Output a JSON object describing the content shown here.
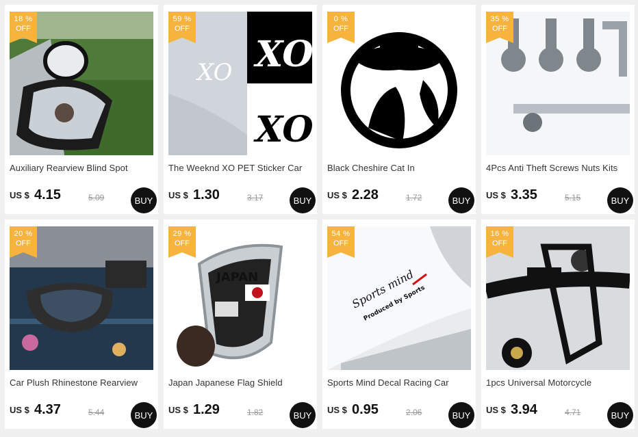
{
  "products": [
    {
      "discount_pct": "18 %",
      "discount_off": "OFF",
      "title": "Auxiliary Rearview Blind Spot",
      "currency": "US $",
      "price": "4.15",
      "old_price": "5.09",
      "buy_label": "BUY"
    },
    {
      "discount_pct": "59 %",
      "discount_off": "OFF",
      "title": "The Weeknd XO PET Sticker Car",
      "currency": "US $",
      "price": "1.30",
      "old_price": "3.17",
      "buy_label": "BUY",
      "image_text": "XO"
    },
    {
      "discount_pct": "0 %",
      "discount_off": "OFF",
      "title": "Black Cheshire Cat In",
      "currency": "US $",
      "price": "2.28",
      "old_price": "1.72",
      "buy_label": "BUY"
    },
    {
      "discount_pct": "35 %",
      "discount_off": "OFF",
      "title": "4Pcs Anti Theft Screws Nuts Kits",
      "currency": "US $",
      "price": "3.35",
      "old_price": "5.15",
      "buy_label": "BUY"
    },
    {
      "discount_pct": "20 %",
      "discount_off": "OFF",
      "title": "Car Plush Rhinestone Rearview",
      "currency": "US $",
      "price": "4.37",
      "old_price": "5.44",
      "buy_label": "BUY"
    },
    {
      "discount_pct": "29 %",
      "discount_off": "OFF",
      "title": "Japan Japanese Flag Shield",
      "currency": "US $",
      "price": "1.29",
      "old_price": "1.82",
      "buy_label": "BUY",
      "image_text": "JAPAN"
    },
    {
      "discount_pct": "54 %",
      "discount_off": "OFF",
      "title": "Sports Mind Decal Racing Car",
      "currency": "US $",
      "price": "0.95",
      "old_price": "2.06",
      "buy_label": "BUY",
      "image_text": "Sports mind",
      "image_text_small": "Produced by Sports"
    },
    {
      "discount_pct": "16 %",
      "discount_off": "OFF",
      "title": "1pcs Universal Motorcycle",
      "currency": "US $",
      "price": "3.94",
      "old_price": "4.71",
      "buy_label": "BUY"
    }
  ],
  "colors": {
    "badge": "#f6b33e",
    "buy_button": "#111111",
    "background": "#f0f0f0"
  }
}
